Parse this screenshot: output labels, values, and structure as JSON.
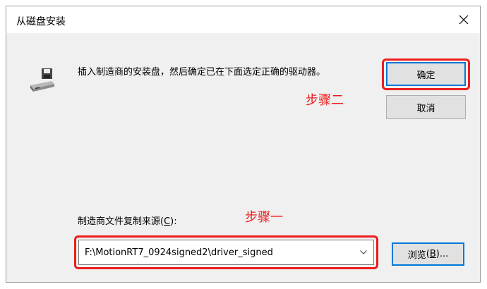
{
  "window": {
    "title": "从磁盘安装",
    "close_label": "×"
  },
  "instructions": "插入制造商的安装盘，然后确定已在下面选定正确的驱动器。",
  "buttons": {
    "ok_label": "确定",
    "cancel_label": "取消",
    "browse_label": "浏览",
    "browse_mnemonic": "B",
    "browse_suffix": "..."
  },
  "source": {
    "label": "制造商文件复制来源",
    "mnemonic": "C",
    "path": "F:\\MotionRT7_0924signed2\\driver_signed"
  },
  "annotations": {
    "step_two": "步骤二",
    "step_one": "步骤一"
  },
  "icons": {
    "drive": "floppy-drive-icon",
    "close": "close-icon",
    "dropdown": "chevron-down-icon"
  },
  "colors": {
    "highlight": "#ee1c1c",
    "focus_border": "#0078d7"
  }
}
